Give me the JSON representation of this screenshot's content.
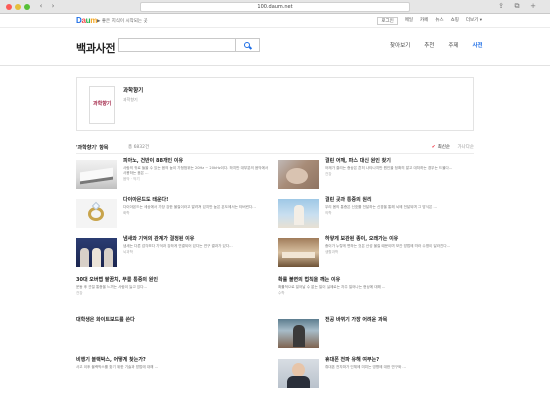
{
  "browser": {
    "url": "100.daum.net"
  },
  "topbar": {
    "logo": [
      "D",
      "a",
      "u",
      "m"
    ],
    "tagline": "▶ 좋은 지식이 시작되는 곳",
    "menu": [
      "로그인",
      "메일",
      "카페",
      "뉴스",
      "쇼핑",
      "이벤트"
    ],
    "more": "더보기 ▾"
  },
  "header": {
    "title": "백과사전",
    "search_value": "",
    "gnb": [
      "찾아보기",
      "추천",
      "주제",
      "사전"
    ],
    "active_gnb": "사전"
  },
  "profile": {
    "name": "과학향기",
    "sub": "과학향기",
    "mark": "과학향기"
  },
  "list": {
    "title": "'과학향기' 항목",
    "count": "총 6832건",
    "sort_a": "최신순",
    "sort_b": "가나다순"
  },
  "articles": [
    {
      "title": "피아노, 건반이 88개인 이유",
      "desc": "사람의 귀로 들을 수 있는 음의 높이 가청범위는 20Hz ~ 20kHz이다. 하지만 대부분의 음악에서 사용하는 음은 ...",
      "cat": "음악 · 악기"
    },
    {
      "title": "결린 어깨, 파스 대신 원인 찾기",
      "desc": "어깨가 결리는 증상은 흔히 나타나지만 원인을 정확히 알고 대처하는 경우는 드물다...",
      "cat": "건강"
    },
    {
      "title": "다이아몬드도 태운다!",
      "desc": "다이아몬드는 세상에서 가장 강한 물질이라고 알려져 있지만 높은 온도에서는 타버린다...",
      "cat": "화학"
    },
    {
      "title": "결린 곳과 통증의 원리",
      "desc": "우리 몸의 통증은 신호를 전달하는 신경을 통해 뇌에 전달되며 그 방식은 ...",
      "cat": "의학"
    },
    {
      "title": "냄새와 기억의 관계가 결정된 이유",
      "desc": "냄새는 다른 감각보다 기억과 강하게 연결되어 있다는 연구 결과가 있다...",
      "cat": "뇌과학"
    },
    {
      "title": "하얗게 보관된 종이, 오래가는 이유",
      "desc": "종이가 누렇게 변하는 것은 산성 물질 때문이며 보관 방법에 따라 수명이 달라진다...",
      "cat": "생활과학"
    },
    {
      "title": "30대 오버랩 팔꿈치, 무릎 통증의 원인",
      "desc": "운동 후 관절 통증을 느끼는 사람이 늘고 있다...",
      "cat": "건강"
    },
    {
      "title": "확률 불변의 법칙을 깨는 이유",
      "desc": "확률적으로 일어날 수 없는 일이 실제로는 자주 일어나는 현상에 대해 ...",
      "cat": "수학"
    },
    {
      "title": "대학생은 화이트보드를 쓴다",
      "desc": "",
      "cat": ""
    },
    {
      "title": "전공 바뀌기 가장 어려운 과목",
      "desc": "",
      "cat": ""
    },
    {
      "title": "비행기 블랙박스, 어떻게 찾는가?",
      "desc": "사고 이후 블랙박스를 찾기 위한 기술과 방법에 대해 ...",
      "cat": ""
    },
    {
      "title": "휴대폰 전파 유해 여부는?",
      "desc": "휴대폰 전자파가 인체에 미치는 영향에 대한 연구와 ...",
      "cat": ""
    }
  ]
}
